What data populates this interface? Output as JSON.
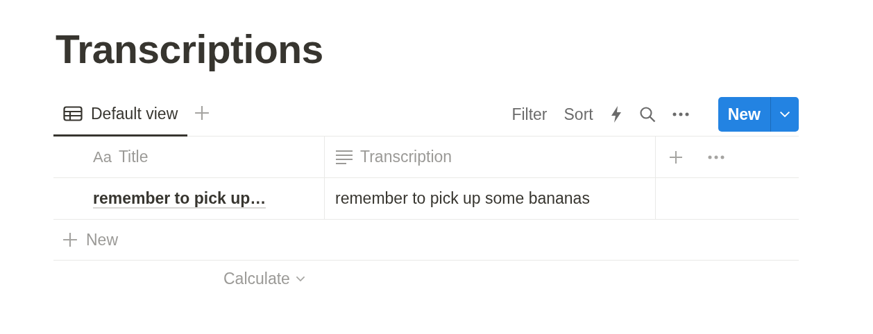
{
  "title": "Transcriptions",
  "views": [
    {
      "label": "Default view",
      "selected": true
    }
  ],
  "toolbar": {
    "filter": "Filter",
    "sort": "Sort",
    "new_button": "New"
  },
  "table": {
    "columns": [
      {
        "kind": "title",
        "icon_text": "Aa",
        "label": "Title"
      },
      {
        "kind": "text",
        "label": "Transcription"
      }
    ],
    "rows": [
      {
        "cells": [
          "remember to pick up…",
          "remember to pick up some bananas"
        ]
      }
    ],
    "add_row": "New",
    "calculate": "Calculate"
  }
}
